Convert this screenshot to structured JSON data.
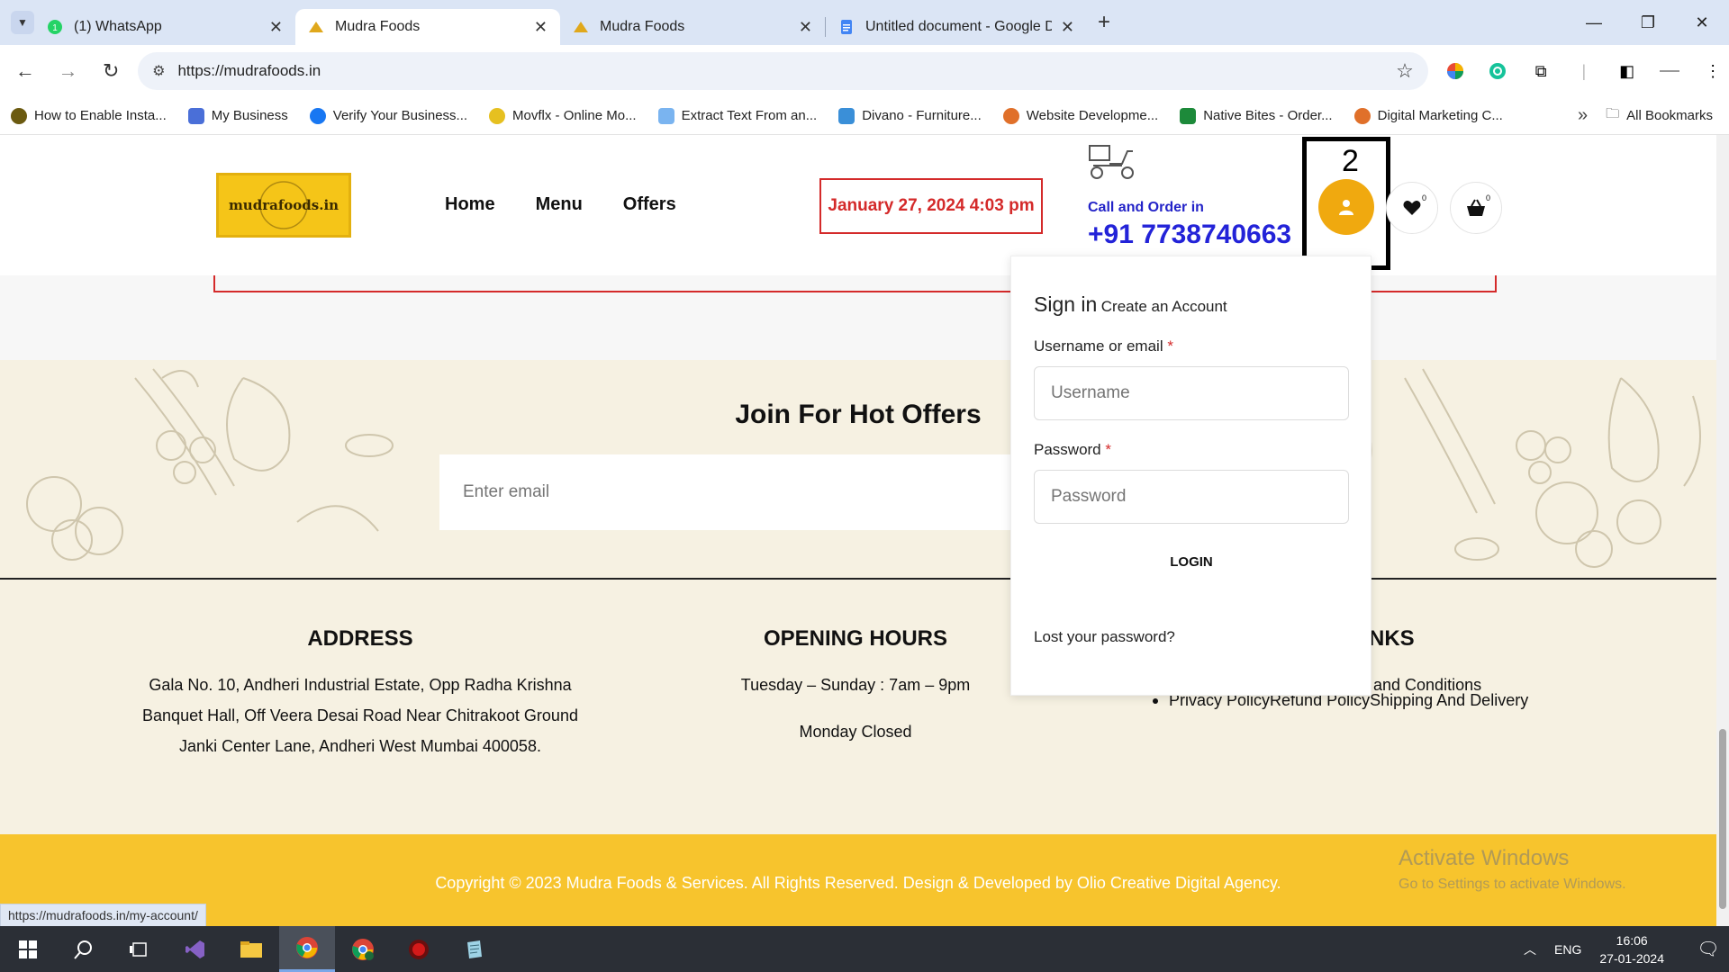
{
  "browser": {
    "tabs": [
      {
        "title": "(1) WhatsApp",
        "active": false
      },
      {
        "title": "Mudra Foods",
        "active": true
      },
      {
        "title": "Mudra Foods",
        "active": false
      },
      {
        "title": "Untitled document - Google Do",
        "active": false
      }
    ],
    "url": "https://mudrafoods.in",
    "bookmarks": [
      "How to Enable Insta...",
      "My Business",
      "Verify Your Business...",
      "Movflx - Online Mo...",
      "Extract Text From an...",
      "Divano - Furniture...",
      "Website Developme...",
      "Native Bites - Order...",
      "Digital Marketing C..."
    ],
    "all_bookmarks": "All Bookmarks",
    "status_url": "https://mudrafoods.in/my-account/"
  },
  "header": {
    "logo_text": "mudrafoods.in",
    "nav": [
      "Home",
      "Menu",
      "Offers"
    ],
    "datetime": "January 27, 2024 4:03 pm",
    "call_label": "Call and Order in",
    "phone": "+91 7738740663",
    "annotation_number": "2",
    "wishlist_count": "0",
    "cart_count": "0"
  },
  "newsletter": {
    "title": "Join For Hot Offers",
    "email_placeholder": "Enter email"
  },
  "footer": {
    "address_title": "ADDRESS",
    "address_lines": [
      "Gala No. 10, Andheri Industrial Estate, Opp Radha Krishna",
      "Banquet Hall, Off Veera Desai Road Near Chitrakoot Ground",
      "Janki Center Lane,  Andheri West Mumbai 400058."
    ],
    "hours_title": "OPENING HOURS",
    "hours_line1": "Tuesday – Sunday : 7am – 9pm",
    "hours_line2": "Monday Closed",
    "links_title_visible": "NKS",
    "links_row1_visible": "and Conditions",
    "links": [
      "Privacy Policy",
      "Refund Policy",
      "Shipping And Delivery"
    ],
    "copyright": "Copyright © 2023 Mudra Foods & Services. All Rights Reserved. Design & Developed by Olio Creative Digital Agency."
  },
  "watermark": {
    "line1": "Activate Windows",
    "line2": "Go to Settings to activate Windows."
  },
  "login": {
    "signin": "Sign in",
    "create": "Create an Account",
    "username_label": "Username or email",
    "username_placeholder": "Username",
    "password_label": "Password",
    "password_placeholder": "Password",
    "required_mark": "*",
    "login_button": "LOGIN",
    "lost_password": "Lost your password?"
  },
  "taskbar": {
    "lang": "ENG",
    "time": "16:06",
    "date": "27-01-2024"
  },
  "colors": {
    "accent_orange": "#f0a90f",
    "footer_yellow": "#f7c42d",
    "phone_blue": "#2323d8",
    "date_red": "#d42a2a"
  }
}
